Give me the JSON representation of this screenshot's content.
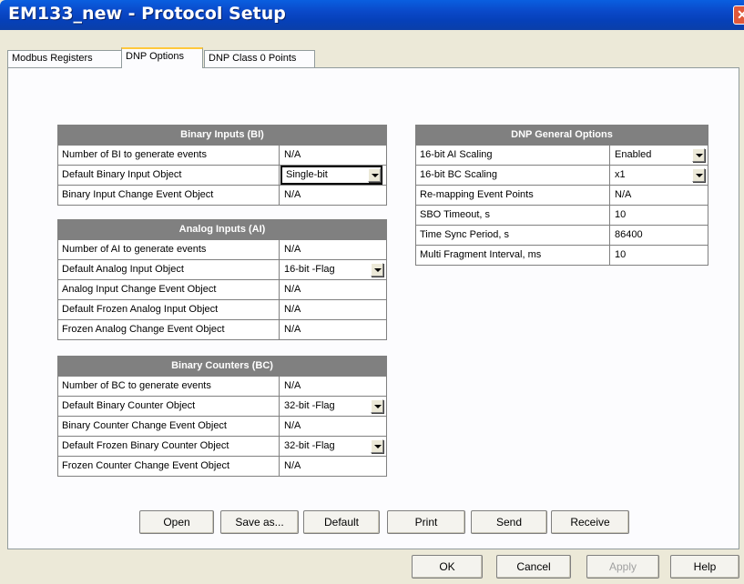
{
  "window": {
    "title": "EM133_new - Protocol Setup",
    "close": "✕"
  },
  "tabs": [
    {
      "label": "Modbus Registers"
    },
    {
      "label": "DNP Options"
    },
    {
      "label": "DNP Class 0 Points"
    }
  ],
  "binary_inputs": {
    "title": "Binary Inputs (BI)",
    "rows": [
      {
        "label": "Number of BI to generate events",
        "value": "N/A"
      },
      {
        "label": "Default Binary Input Object",
        "value": "Single-bit"
      },
      {
        "label": "Binary Input Change Event Object",
        "value": "N/A"
      }
    ]
  },
  "analog_inputs": {
    "title": "Analog Inputs (AI)",
    "rows": [
      {
        "label": "Number of AI to generate events",
        "value": "N/A"
      },
      {
        "label": "Default Analog Input Object",
        "value": "16-bit -Flag"
      },
      {
        "label": "Analog Input Change Event Object",
        "value": "N/A"
      },
      {
        "label": "Default Frozen Analog Input Object",
        "value": "N/A"
      },
      {
        "label": "Frozen Analog Change Event Object",
        "value": "N/A"
      }
    ]
  },
  "binary_counters": {
    "title": "Binary Counters (BC)",
    "rows": [
      {
        "label": "Number of BC to generate events",
        "value": "N/A"
      },
      {
        "label": "Default Binary Counter Object",
        "value": "32-bit -Flag"
      },
      {
        "label": "Binary Counter Change Event Object",
        "value": "N/A"
      },
      {
        "label": "Default Frozen Binary Counter Object",
        "value": "32-bit -Flag"
      },
      {
        "label": "Frozen Counter Change Event Object",
        "value": "N/A"
      }
    ]
  },
  "general": {
    "title": "DNP General Options",
    "rows": [
      {
        "label": "16-bit AI Scaling",
        "value": "Enabled"
      },
      {
        "label": "16-bit BC Scaling",
        "value": "x1"
      },
      {
        "label": "Re-mapping Event Points",
        "value": "N/A"
      },
      {
        "label": "SBO Timeout, s",
        "value": "10"
      },
      {
        "label": "Time Sync Period, s",
        "value": "86400"
      },
      {
        "label": "Multi Fragment Interval, ms",
        "value": "10"
      }
    ]
  },
  "actions": {
    "open": "Open",
    "save_as": "Save as...",
    "default": "Default",
    "print": "Print",
    "send": "Send",
    "receive": "Receive"
  },
  "dialog": {
    "ok": "OK",
    "cancel": "Cancel",
    "apply": "Apply",
    "help": "Help"
  }
}
